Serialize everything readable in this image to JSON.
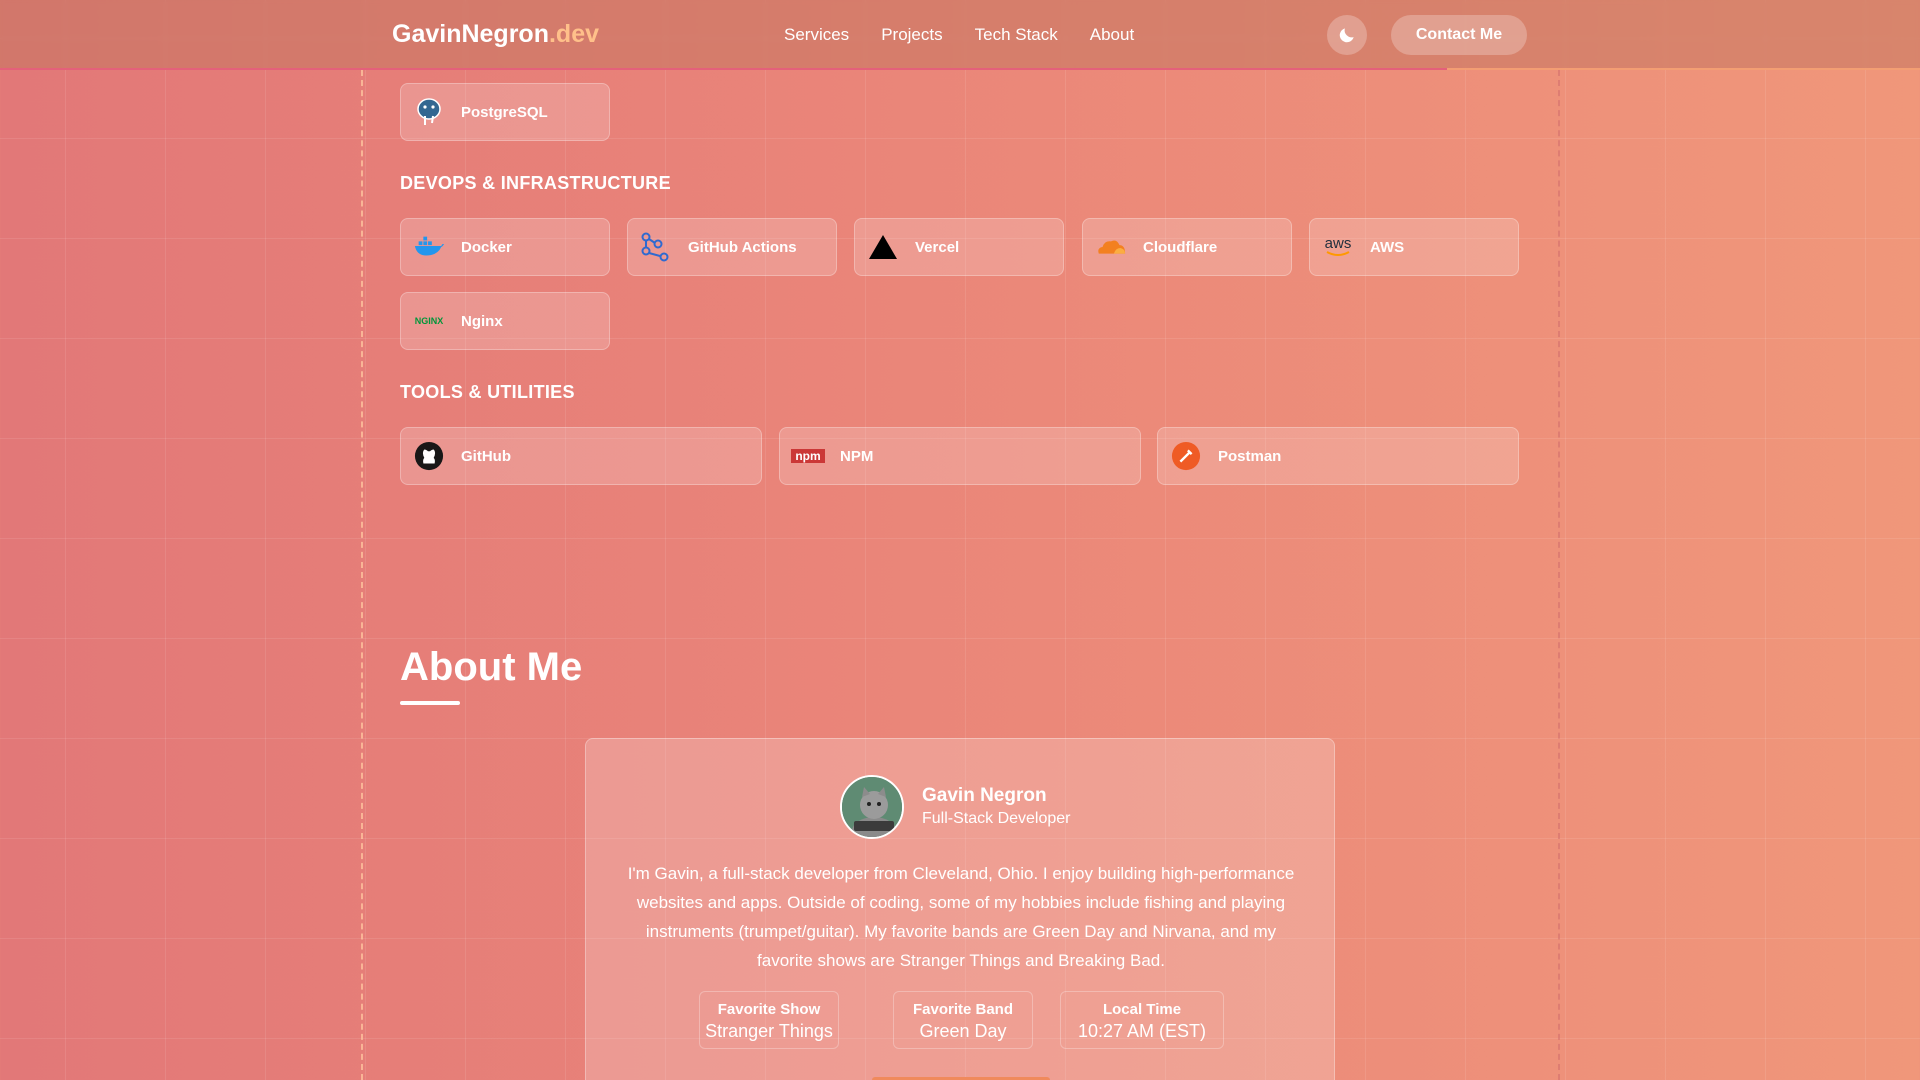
{
  "header": {
    "logo_name": "GavinNegron",
    "logo_tld": ".dev",
    "nav": [
      "Services",
      "Projects",
      "Tech Stack",
      "About"
    ],
    "contact_label": "Contact Me",
    "theme_icon": "moon-icon"
  },
  "tech": {
    "databases_items": [
      {
        "label": "PostgreSQL",
        "icon": "postgresql-icon"
      }
    ],
    "devops_heading": "DEVOPS & INFRASTRUCTURE",
    "devops_items": [
      {
        "label": "Docker",
        "icon": "docker-icon"
      },
      {
        "label": "GitHub Actions",
        "icon": "github-actions-icon"
      },
      {
        "label": "Vercel",
        "icon": "vercel-icon"
      },
      {
        "label": "Cloudflare",
        "icon": "cloudflare-icon"
      },
      {
        "label": "AWS",
        "icon": "aws-icon"
      },
      {
        "label": "Nginx",
        "icon": "nginx-icon"
      }
    ],
    "tools_heading": "TOOLS & UTILITIES",
    "tools_items": [
      {
        "label": "GitHub",
        "icon": "github-icon"
      },
      {
        "label": "NPM",
        "icon": "npm-icon"
      },
      {
        "label": "Postman",
        "icon": "postman-icon"
      }
    ],
    "icon_text": {
      "aws": "aws",
      "nginx": "NGINX",
      "npm": "npm"
    }
  },
  "about": {
    "title": "About Me",
    "name": "Gavin Negron",
    "role": "Full-Stack Developer",
    "bio": "I'm Gavin, a full-stack developer from Cleveland, Ohio. I enjoy building high-performance websites and apps. Outside of coding, some of my hobbies include fishing and playing instruments (trumpet/guitar). My favorite bands are Green Day and Nirvana, and my favorite shows are Stranger Things and Breaking Bad.",
    "stats": [
      {
        "label": "Favorite Show",
        "value": "Stranger Things"
      },
      {
        "label": "Favorite Band",
        "value": "Green Day"
      },
      {
        "label": "Local Time",
        "value": "10:27 AM (EST)"
      }
    ]
  },
  "colors": {
    "accent_orange": "#ffc08a",
    "progress": "#e4607a",
    "bg_start": "#e27878",
    "bg_end": "#f0977a"
  }
}
